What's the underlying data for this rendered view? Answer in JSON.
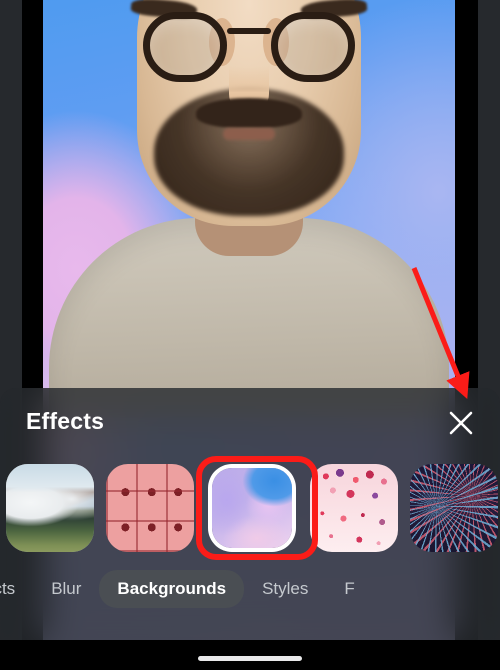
{
  "app": {
    "panel_title": "Effects",
    "close_icon": "close-x-icon"
  },
  "video": {
    "description": "Front camera self-view of a bald man with dark-rimmed round glasses, beard and moustache, wearing a beige t-shirt, in front of a blue and pink watercolor virtual background."
  },
  "backgrounds": {
    "items": [
      {
        "id": "mountains",
        "label": "Mountains",
        "icon": "mountain-landscape-thumbnail",
        "selected": false
      },
      {
        "id": "tiles",
        "label": "Pink Tiles",
        "icon": "pink-tile-grid-thumbnail",
        "selected": false
      },
      {
        "id": "watercolor",
        "label": "Watercolor",
        "icon": "blue-pink-watercolor-thumbnail",
        "selected": true
      },
      {
        "id": "confetti",
        "label": "Confetti",
        "icon": "pink-confetti-thumbnail",
        "selected": false
      },
      {
        "id": "fireworks",
        "label": "Fireworks",
        "icon": "fireworks-night-thumbnail",
        "selected": false
      }
    ]
  },
  "tabs": [
    {
      "id": "effects",
      "label": "ects",
      "active": false,
      "clipped": true
    },
    {
      "id": "blur",
      "label": "Blur",
      "active": false,
      "clipped": false
    },
    {
      "id": "backgrounds",
      "label": "Backgrounds",
      "active": true,
      "clipped": false
    },
    {
      "id": "styles",
      "label": "Styles",
      "active": false,
      "clipped": false
    },
    {
      "id": "filters",
      "label": "F",
      "active": false,
      "clipped": true
    }
  ],
  "annotations": {
    "arrow_color": "#fb1c18",
    "highlight_color": "#fb1c18",
    "arrow_points_to": "close-button"
  },
  "colors": {
    "panel_background": "#26292d",
    "tab_active_pill": "#4a4e53",
    "tab_inactive_text": "#c5c9ce",
    "text_primary": "#ffffff",
    "system_black": "#000000",
    "home_indicator": "#e9e9ea"
  }
}
